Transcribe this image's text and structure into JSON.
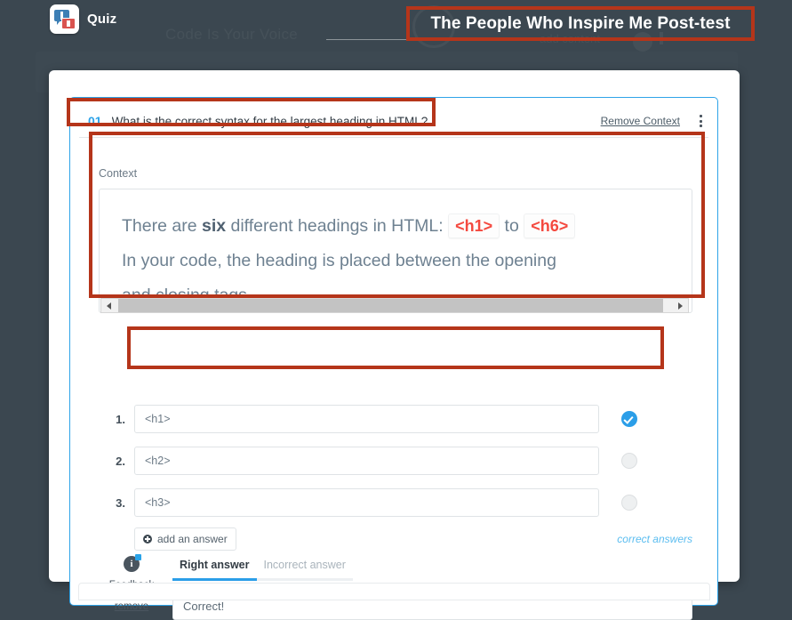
{
  "app": {
    "logo_icon": "quiz-speech-bubbles-icon",
    "logo_label": "Quiz",
    "page_title": "The People Who Inspire Me Post-test"
  },
  "background_ghost": {
    "brand_text": "Code Is Your Voice",
    "add_content_text": "add content"
  },
  "question": {
    "number": "01",
    "text": "What is the correct syntax for the largest heading in HTML?",
    "remove_context_label": "Remove Context",
    "kebab_icon": "more-vertical-icon"
  },
  "context": {
    "label": "Context",
    "line1_prefix": "There are ",
    "line1_bold": "six",
    "line1_mid": " different headings in HTML: ",
    "line1_tag_open": "<h1>",
    "line1_between": " to ",
    "line1_tag_close": "<h6>",
    "line2": "In your code, the heading is placed between the opening",
    "line3": "and closing tags.",
    "scrollbar": {
      "left_arrow_icon": "caret-left-icon",
      "right_arrow_icon": "caret-right-icon",
      "thumb_name": "horizontal-scroll-thumb"
    }
  },
  "answers": {
    "items": [
      {
        "index": "1.",
        "value": "<h1>",
        "correct": true,
        "toggle_icon": "check-circle-filled-icon"
      },
      {
        "index": "2.",
        "value": "<h2>",
        "correct": false,
        "toggle_icon": "circle-empty-icon"
      },
      {
        "index": "3.",
        "value": "<h3>",
        "correct": false,
        "toggle_icon": "circle-empty-icon"
      }
    ],
    "add_answer_label": "add an answer",
    "add_answer_icon": "plus-circle-icon",
    "correct_answers_link": "correct answers"
  },
  "feedback": {
    "icon": "info-circle-icon",
    "label": "Feedback",
    "remove_label": "remove",
    "tabs": [
      {
        "label": "Right answer",
        "active": true
      },
      {
        "label": "Incorrect answer",
        "active": false
      }
    ],
    "value": "Correct!"
  },
  "colors": {
    "page_background": "#3b4750",
    "annotation_red": "#b5351a",
    "accent_blue": "#2ea3e8",
    "code_red": "#f4493f",
    "card_white": "#ffffff"
  }
}
